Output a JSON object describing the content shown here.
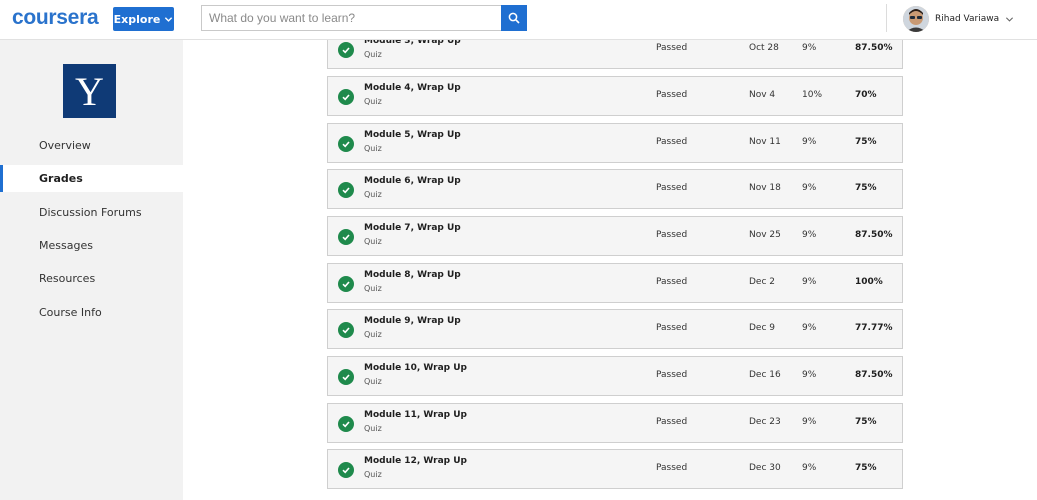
{
  "header": {
    "logo": "coursera",
    "explore_label": "Explore",
    "search_placeholder": "What do you want to learn?",
    "user_name": "Rihad Variawa"
  },
  "sidebar": {
    "logo_letter": "Y",
    "items": [
      {
        "label": "Overview",
        "active": false
      },
      {
        "label": "Grades",
        "active": true
      },
      {
        "label": "Discussion Forums",
        "active": false
      },
      {
        "label": "Messages",
        "active": false
      },
      {
        "label": "Resources",
        "active": false
      },
      {
        "label": "Course Info",
        "active": false
      }
    ]
  },
  "grades": [
    {
      "title": "Module 3, Wrap Up",
      "type": "Quiz",
      "status": "Passed",
      "due": "Oct 28",
      "weight": "9%",
      "grade": "87.50%"
    },
    {
      "title": "Module 4, Wrap Up",
      "type": "Quiz",
      "status": "Passed",
      "due": "Nov 4",
      "weight": "10%",
      "grade": "70%"
    },
    {
      "title": "Module 5, Wrap Up",
      "type": "Quiz",
      "status": "Passed",
      "due": "Nov 11",
      "weight": "9%",
      "grade": "75%"
    },
    {
      "title": "Module 6, Wrap Up",
      "type": "Quiz",
      "status": "Passed",
      "due": "Nov 18",
      "weight": "9%",
      "grade": "75%"
    },
    {
      "title": "Module 7, Wrap Up",
      "type": "Quiz",
      "status": "Passed",
      "due": "Nov 25",
      "weight": "9%",
      "grade": "87.50%"
    },
    {
      "title": "Module 8, Wrap Up",
      "type": "Quiz",
      "status": "Passed",
      "due": "Dec 2",
      "weight": "9%",
      "grade": "100%"
    },
    {
      "title": "Module 9, Wrap Up",
      "type": "Quiz",
      "status": "Passed",
      "due": "Dec 9",
      "weight": "9%",
      "grade": "77.77%"
    },
    {
      "title": "Module 10, Wrap Up",
      "type": "Quiz",
      "status": "Passed",
      "due": "Dec 16",
      "weight": "9%",
      "grade": "87.50%"
    },
    {
      "title": "Module 11, Wrap Up",
      "type": "Quiz",
      "status": "Passed",
      "due": "Dec 23",
      "weight": "9%",
      "grade": "75%"
    },
    {
      "title": "Module 12, Wrap Up",
      "type": "Quiz",
      "status": "Passed",
      "due": "Dec 30",
      "weight": "9%",
      "grade": "75%"
    }
  ],
  "colors": {
    "brand": "#2a73cc",
    "accent": "#1f6fd1",
    "pass": "#1f8a4c",
    "yale": "#0f3a76"
  },
  "icons": {
    "search": "search-icon",
    "check": "check-circle-icon",
    "chevron": "chevron-down-icon"
  }
}
